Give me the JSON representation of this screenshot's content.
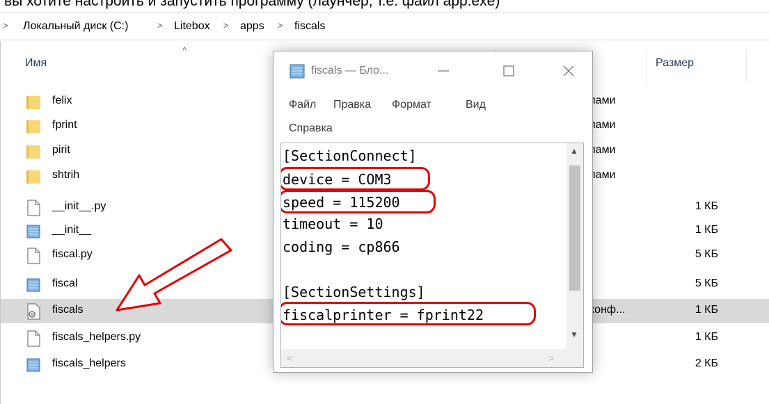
{
  "top_strip_text": "вы хотите настроить и запустить программу (лаунчер, т.е. файл app.exe)",
  "breadcrumb": [
    "Локальный диск (C:)",
    "Litebox",
    "apps",
    "fiscals"
  ],
  "columns": {
    "name": "Имя",
    "size": "Размер"
  },
  "files": [
    {
      "name": "felix",
      "icon": "folder-icon",
      "type": "пами",
      "size": ""
    },
    {
      "name": "fprint",
      "icon": "folder-icon",
      "type": "пами",
      "size": ""
    },
    {
      "name": "pirit",
      "icon": "folder-icon",
      "type": "пами",
      "size": ""
    },
    {
      "name": "shtrih",
      "icon": "folder-icon",
      "type": "пами",
      "size": ""
    },
    {
      "name": "__init__.py",
      "icon": "blank-file-icon",
      "type": "",
      "size": "1 КБ"
    },
    {
      "name": "__init__",
      "icon": "notepad-file-icon",
      "type": "",
      "size": "1 КБ"
    },
    {
      "name": "fiscal.py",
      "icon": "blank-file-icon",
      "type": "",
      "size": "5 КБ"
    },
    {
      "name": "fiscal",
      "icon": "notepad-file-icon",
      "type": "",
      "size": "5 КБ"
    },
    {
      "name": "fiscals",
      "icon": "settings-file-icon",
      "type": "конф...",
      "size": "1 КБ"
    },
    {
      "name": "fiscals_helpers.py",
      "icon": "blank-file-icon",
      "type": "",
      "size": "1 КБ"
    },
    {
      "name": "fiscals_helpers",
      "icon": "notepad-file-icon",
      "type": "",
      "size": "2 КБ"
    }
  ],
  "notepad": {
    "title": "fiscals — Бло...",
    "menu": [
      "Файл",
      "Правка",
      "Формат",
      "Вид",
      "Справка"
    ],
    "lines": [
      "[SectionConnect]",
      "device = COM3",
      "speed = 115200",
      "timeout = 10",
      "coding = cp866",
      "",
      "[SectionSettings]",
      "fiscalprinter = fprint22"
    ]
  },
  "colors": {
    "annotation": "#e30000",
    "selection": "#d9d9d9",
    "folder": "#f8d775"
  }
}
